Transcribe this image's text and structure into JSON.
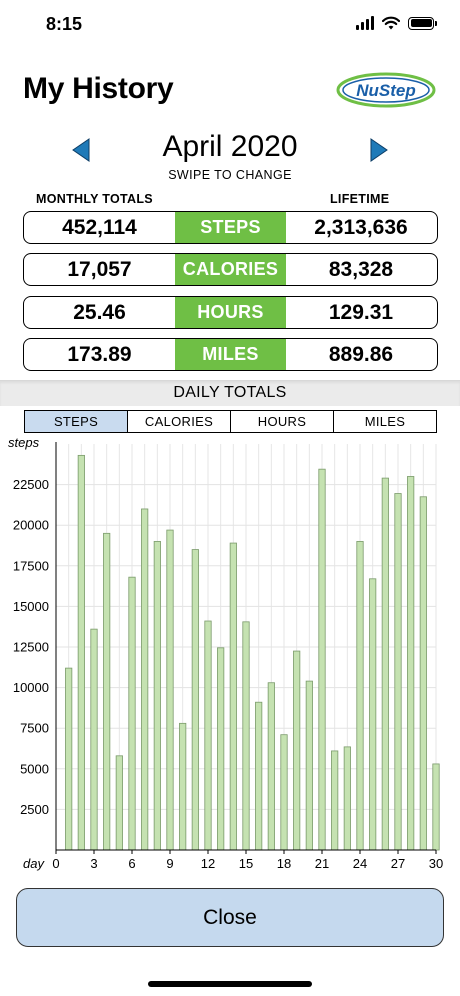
{
  "status": {
    "time": "8:15"
  },
  "header": {
    "title": "My History",
    "logo_text": "NuStep"
  },
  "month": {
    "label": "April 2020",
    "hint": "SWIPE TO CHANGE"
  },
  "totals": {
    "monthly_heading": "MONTHLY TOTALS",
    "lifetime_heading": "LIFETIME",
    "rows": [
      {
        "metric": "STEPS",
        "monthly": "452,114",
        "lifetime": "2,313,636"
      },
      {
        "metric": "CALORIES",
        "monthly": "17,057",
        "lifetime": "83,328"
      },
      {
        "metric": "HOURS",
        "monthly": "25.46",
        "lifetime": "129.31"
      },
      {
        "metric": "MILES",
        "monthly": "173.89",
        "lifetime": "889.86"
      }
    ]
  },
  "daily": {
    "title": "DAILY TOTALS",
    "tabs": [
      "STEPS",
      "CALORIES",
      "HOURS",
      "MILES"
    ],
    "selected_tab": "STEPS"
  },
  "chart_data": {
    "type": "bar",
    "ylabel": "steps",
    "xlabel": "day",
    "ylim": [
      0,
      25000
    ],
    "xlim": [
      0,
      30
    ],
    "yticks": [
      2500,
      5000,
      7500,
      10000,
      12500,
      15000,
      17500,
      20000,
      22500
    ],
    "xticks": [
      0,
      3,
      6,
      9,
      12,
      15,
      18,
      21,
      24,
      27,
      30
    ],
    "grid": true,
    "bar_color": "#c5e2b1",
    "bar_stroke": "#7a9a6a",
    "categories": [
      1,
      2,
      3,
      4,
      5,
      6,
      7,
      8,
      9,
      10,
      11,
      12,
      13,
      14,
      15,
      16,
      17,
      18,
      19,
      20,
      21,
      22,
      23,
      24,
      25,
      26,
      27,
      28,
      29,
      30
    ],
    "values": [
      11200,
      24300,
      13600,
      19500,
      5800,
      16800,
      21000,
      19000,
      19700,
      7800,
      18500,
      14100,
      12450,
      18900,
      14050,
      9100,
      10300,
      7100,
      12250,
      10400,
      23450,
      6100,
      6350,
      19000,
      16700,
      22900,
      21950,
      23000,
      21750,
      5300
    ]
  },
  "close": {
    "label": "Close"
  },
  "colors": {
    "accent_green": "#6fbf45",
    "selected_tab": "#c9dbef",
    "close_button": "#c5d9ee",
    "arrow_blue": "#1f7ab8"
  }
}
